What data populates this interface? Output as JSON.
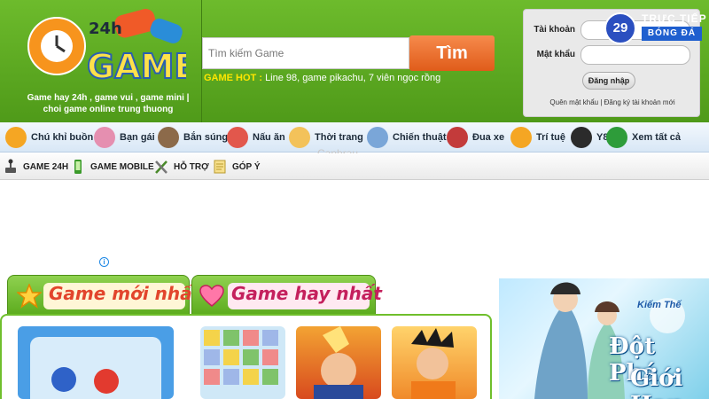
{
  "logo": {
    "top_text": "24h",
    "main_text": "GAME"
  },
  "tagline": "Game hay 24h , game vui , game mini | choi game online trung thuong",
  "search": {
    "placeholder": "Tìm kiếm Game",
    "button_label": "Tìm"
  },
  "hot": {
    "label": "GAME HOT :",
    "text": "Line 98, game pikachu, 7 viên ngọc rồng"
  },
  "login": {
    "username_label": "Tài khoản",
    "password_label": "Mật khẩu",
    "button_label": "Đăng nhập",
    "forgot_label": "Quên mật khẩu",
    "separator": "|",
    "register_label": "Đăng ký tài khoản mới"
  },
  "badge": {
    "number": "29",
    "line1": "TRỰC TIẾP",
    "line2": "BÓNG ĐÁ"
  },
  "categories": [
    {
      "label": "Chú khỉ buồn",
      "icon": "monkey-icon",
      "color": "#f5a623"
    },
    {
      "label": "Bạn gái",
      "icon": "girl-icon",
      "color": "#e58fb0"
    },
    {
      "label": "Bắn súng",
      "icon": "gun-icon",
      "color": "#8c6a4a"
    },
    {
      "label": "Nấu ăn",
      "icon": "chef-icon",
      "color": "#e2574c"
    },
    {
      "label": "Thời trang",
      "icon": "fashion-icon",
      "color": "#f3c25a"
    },
    {
      "label": "Chiến thuật",
      "icon": "sword-icon",
      "color": "#7aa6d8"
    },
    {
      "label": "Đua xe",
      "icon": "car-icon",
      "color": "#c33b3b"
    },
    {
      "label": "Trí tuệ",
      "icon": "brain-icon",
      "color": "#f5a623"
    },
    {
      "label": "Y8",
      "icon": "y8-icon",
      "color": "#2b2b2b"
    },
    {
      "label": "Xem tất cả",
      "icon": "check-circle-icon",
      "color": "#2e9c3a"
    }
  ],
  "menu": [
    {
      "label": "GAME 24H",
      "icon": "joystick-icon"
    },
    {
      "label": "GAME MOBILE",
      "icon": "mobile-icon"
    },
    {
      "label": "HỖ TRỢ",
      "icon": "tools-icon"
    },
    {
      "label": "GÓP Ý",
      "icon": "feedback-icon"
    }
  ],
  "watermark": "Canhrau",
  "tabs": {
    "new_games": "Game mới nhất",
    "hot_games": "Game hay nhất"
  },
  "ad": {
    "line1": "Đột Phá",
    "line2": "Giới Hạn",
    "brand": "Kiếm Thế"
  },
  "colors": {
    "header_green": "#5aaa1c",
    "search_orange": "#e8681f",
    "hot_yellow": "#ffe600"
  }
}
